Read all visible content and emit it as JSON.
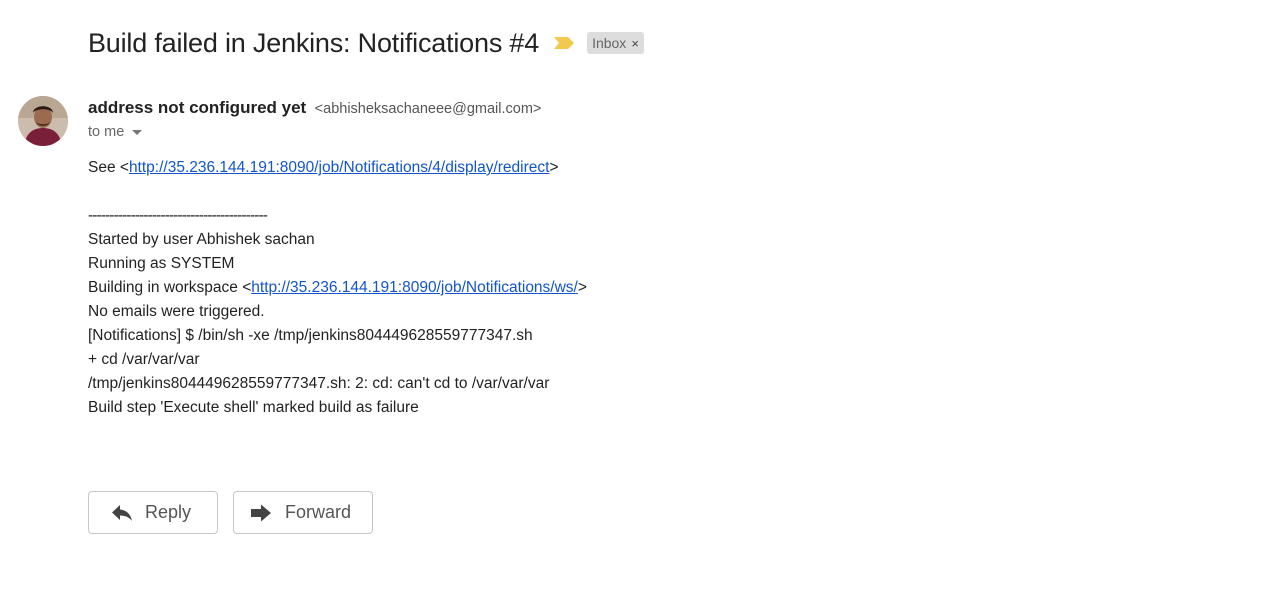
{
  "email": {
    "subject": "Build failed in Jenkins: Notifications #4",
    "label": "Inbox",
    "label_remove": "×",
    "sender_name": "address not configured yet",
    "sender_email": "<abhisheksachaneee@gmail.com>",
    "recipient": "to me"
  },
  "body": {
    "see_prefix": "See <",
    "see_link": "http://35.236.144.191:8090/job/Notifications/4/display/redirect",
    "see_suffix": ">",
    "divider": "------------------------------------------",
    "started_by": "Started by user Abhishek sachan",
    "running_as": "Running as SYSTEM",
    "workspace_prefix": "Building in workspace <",
    "workspace_link": "http://35.236.144.191:8090/job/Notifications/ws/",
    "workspace_suffix": ">",
    "no_emails": "No emails were triggered.",
    "shell_cmd": "[Notifications] $ /bin/sh -xe /tmp/jenkins804449628559777347.sh",
    "cd_cmd": "+ cd /var/var/var",
    "cd_error": "/tmp/jenkins804449628559777347.sh: 2: cd: can't cd to /var/var/var",
    "build_step": "Build step 'Execute shell' marked build as failure"
  },
  "actions": {
    "reply_label": "Reply",
    "forward_label": "Forward"
  },
  "colors": {
    "link": "#1155cc",
    "importance_marker": "#f2c94c",
    "label_chip_bg": "#dddddd"
  },
  "icons": {
    "importance": "importance-marker-icon",
    "reply": "reply-arrow-icon",
    "forward": "forward-arrow-icon",
    "caret": "caret-down-icon"
  }
}
